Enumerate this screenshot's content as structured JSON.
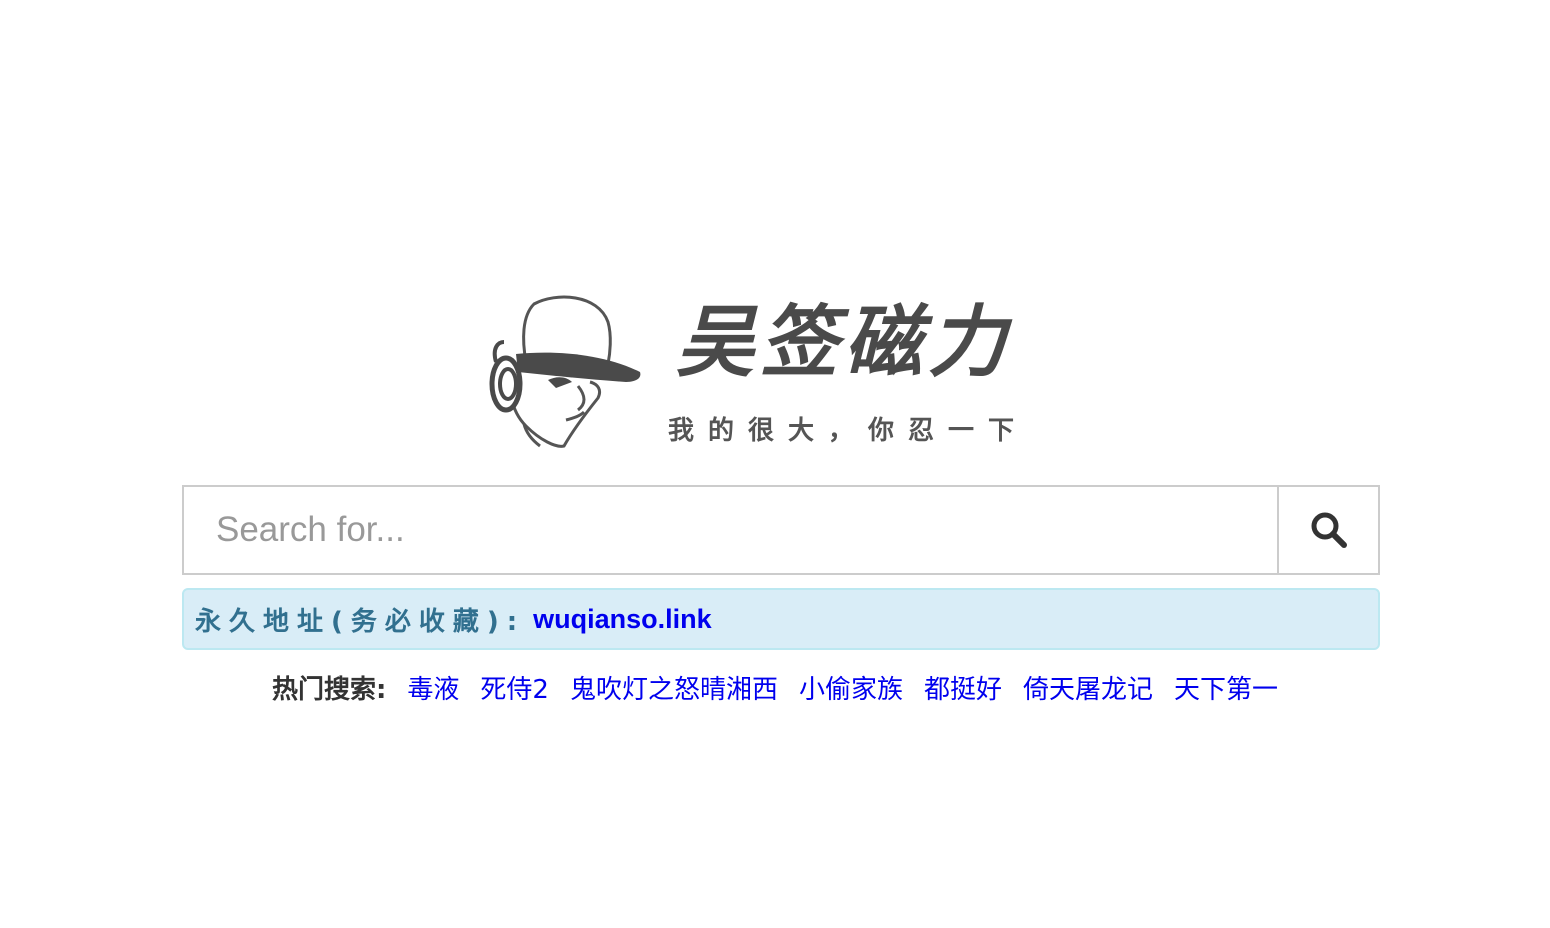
{
  "logo": {
    "title": "吴签磁力",
    "slogan": "我的很大，你忍一下"
  },
  "search": {
    "placeholder": "Search for...",
    "value": "",
    "button_icon": "search-icon"
  },
  "alert": {
    "label": "永久地址(务必收藏):",
    "link_text": "wuqianso.link"
  },
  "hot_searches": {
    "label": "热门搜索:",
    "items": [
      "毒液",
      "死侍2",
      "鬼吹灯之怒晴湘西",
      "小偷家族",
      "都挺好",
      "倚天屠龙记",
      "天下第一"
    ]
  },
  "colors": {
    "alert_bg": "#d9edf7",
    "alert_border": "#bce8f1",
    "alert_text": "#31708f",
    "link": "#0000ee",
    "logo_gray": "#4a4a4a"
  }
}
